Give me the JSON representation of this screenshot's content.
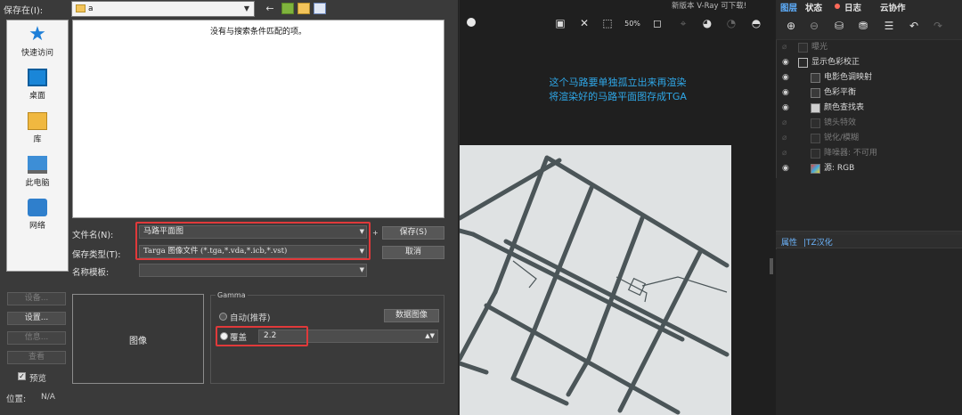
{
  "dialog": {
    "save_in_label": "保存在(I):",
    "save_in_value": "a",
    "places": [
      "快速访问",
      "桌面",
      "库",
      "此电脑",
      "网络"
    ],
    "empty_message": "没有与搜索条件匹配的项。",
    "filename_label": "文件名(N):",
    "filename_value": "马路平面图",
    "filetype_label": "保存类型(T):",
    "filetype_value": "Targa 图像文件 (*.tga,*.vda,*.icb,*.vst)",
    "template_label": "名称模板:",
    "template_value": "",
    "save_button": "保存(S)",
    "cancel_button": "取消",
    "devices_button": "设备...",
    "setup_button": "设置...",
    "info_button": "信息...",
    "view_button": "查看",
    "preview_label": "预览",
    "position_label": "位置:",
    "position_value": "N/A",
    "image_label": "图像",
    "gamma_title": "Gamma",
    "auto_label": "自动(推荐)",
    "data_image_button": "数据图像",
    "override_label": "覆盖",
    "override_value": "2.2"
  },
  "viewport": {
    "update_note": "新版本 V-Ray 可下载!",
    "annotation_line1": "这个马路要单独孤立出来再渲染",
    "annotation_line2": "将渲染好的马路平面图存成TGA"
  },
  "right_panel": {
    "tabs": [
      "图层",
      "状态",
      "日志",
      "云协作"
    ],
    "layers": [
      {
        "label": "曝光",
        "visible": false,
        "dim": true
      },
      {
        "label": "显示色彩校正",
        "visible": true,
        "dim": false
      },
      {
        "label": "电影色调映射",
        "visible": true,
        "dim": false
      },
      {
        "label": "色彩平衡",
        "visible": true,
        "dim": false
      },
      {
        "label": "颜色查找表",
        "visible": true,
        "dim": false
      },
      {
        "label": "镜头特效",
        "visible": false,
        "dim": true
      },
      {
        "label": "锐化/模糊",
        "visible": false,
        "dim": true
      },
      {
        "label": "降噪器: 不可用",
        "visible": false,
        "dim": true
      },
      {
        "label": "源: RGB",
        "visible": true,
        "dim": false
      }
    ],
    "props_tab": "属性",
    "props_tab_suffix": "|TZ汉化"
  },
  "colors": {
    "accent_highlight": "#e0393a",
    "annotation_text": "#2fa6e6",
    "road_color": "#4b5558",
    "canvas_bg": "#dfe2e3"
  }
}
